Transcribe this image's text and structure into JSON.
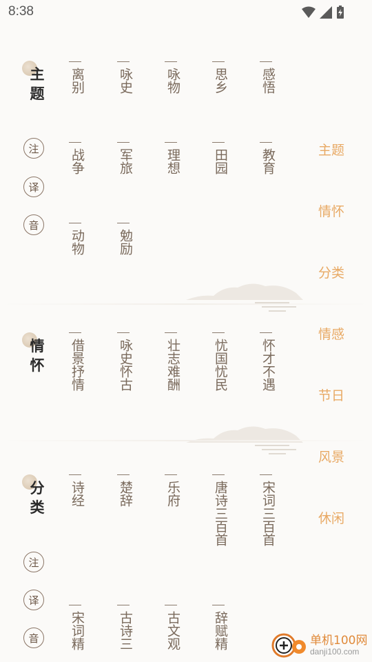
{
  "status": {
    "time": "8:38"
  },
  "sections": [
    {
      "title": [
        "主",
        "题"
      ],
      "rows": [
        [
          "离别",
          "咏史",
          "咏物",
          "思乡",
          "感悟"
        ],
        [
          "战争",
          "军旅",
          "理想",
          "田园",
          "教育"
        ],
        [
          "动物",
          "勉励"
        ]
      ]
    },
    {
      "title": [
        "情",
        "怀"
      ],
      "rows": [
        [
          "借景抒情",
          "咏史怀古",
          "壮志难酬",
          "忧国忧民",
          "怀才不遇"
        ]
      ]
    },
    {
      "title": [
        "分",
        "类"
      ],
      "rows": [
        [
          "诗经",
          "楚辞",
          "乐府",
          "唐诗三百首",
          "宋词三百首"
        ],
        [
          "宋词精",
          "古诗三",
          "古文观",
          "辞赋精"
        ]
      ]
    }
  ],
  "tools": [
    "注",
    "译",
    "音"
  ],
  "side_nav": [
    "主题",
    "情怀",
    "分类",
    "情感",
    "节日",
    "风景",
    "休闲"
  ],
  "watermark": {
    "line1": "单机100网",
    "line2": "danji100.com"
  },
  "colors": {
    "accent": "#e8a964",
    "text": "#6e5f52",
    "title": "#2b2b2b"
  }
}
